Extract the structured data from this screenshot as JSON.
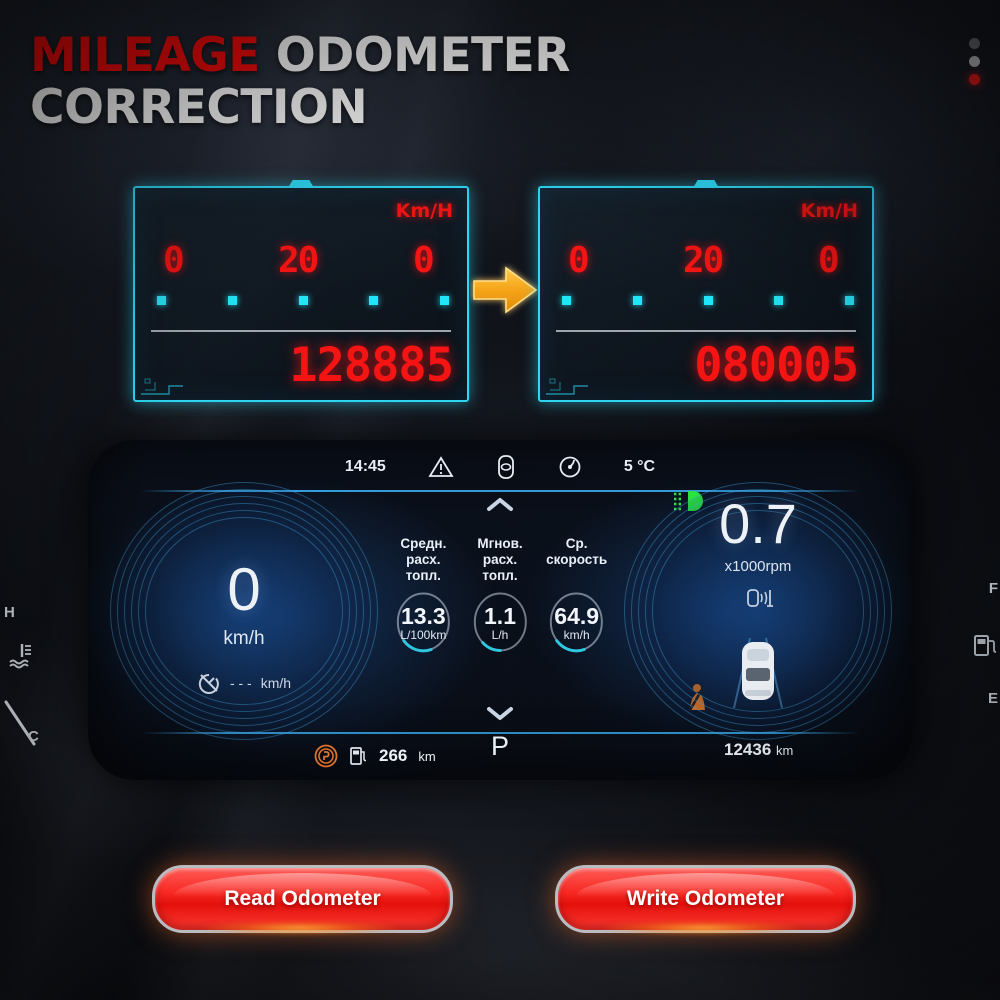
{
  "header": {
    "line1_highlight": "MILEAGE",
    "line1_rest": "ODOMETER",
    "line2": "CORRECTION"
  },
  "menu": {
    "name": "more-options",
    "dots": 3
  },
  "odometer_before": {
    "unit_label": "Km/H",
    "segment_values": [
      "0",
      "20",
      "0"
    ],
    "marker_count": 5,
    "mileage": "128885"
  },
  "odometer_after": {
    "unit_label": "Km/H",
    "segment_values": [
      "0",
      "20",
      "0"
    ],
    "marker_count": 5,
    "mileage": "080005"
  },
  "transition": {
    "icon": "arrow-right-icon"
  },
  "cluster": {
    "top_bar": {
      "time": "14:45",
      "temperature": "5 °C",
      "icons": [
        "warning-triangle-icon",
        "door-ajar-icon",
        "tire-pressure-icon"
      ]
    },
    "indicators": {
      "high_beam": "headlight-icon",
      "up_chevron": "chevron-up-icon",
      "down_chevron": "chevron-down-icon",
      "seatbelt": "seatbelt-warning-icon"
    },
    "speedometer": {
      "value": "0",
      "unit": "km/h",
      "cruise_icon": "cruise-control-icon",
      "cruise_value": "- - -",
      "cruise_unit": "km/h"
    },
    "tachometer": {
      "value": "0.7",
      "unit": "x1000rpm",
      "lane_icon": "lane-assist-icon",
      "car_icon": "car-top-view-icon"
    },
    "trip_computer": [
      {
        "label": "Средн. расх. топл.",
        "value": "13.3",
        "unit": "L/100km"
      },
      {
        "label": "Мгнов. расх. топл.",
        "value": "1.1",
        "unit": "L/h"
      },
      {
        "label": "Ср. скорость",
        "value": "64.9",
        "unit": "km/h"
      }
    ],
    "bottom_bar": {
      "parking_brake_icon": "parking-brake-icon",
      "fuel_icon": "fuel-pump-icon",
      "range": "266",
      "range_unit": "km",
      "gear": "P",
      "odometer": "12436",
      "odometer_unit": "km"
    }
  },
  "edge_gauges": {
    "temp_high": "H",
    "temp_low": "C",
    "temp_icon": "coolant-temp-icon",
    "fuel_full": "F",
    "fuel_empty": "E",
    "fuel_icon": "fuel-pump-icon"
  },
  "actions": {
    "read_label": "Read Odometer",
    "write_label": "Write Odometer"
  },
  "colors": {
    "accent_red": "#f50b0b",
    "panel_cyan": "#2fd9f5",
    "led_red": "#f41414",
    "marker_cyan": "#22e6f7",
    "arrow_orange": "#f5a419",
    "cluster_blue": "#3aaaeb"
  }
}
